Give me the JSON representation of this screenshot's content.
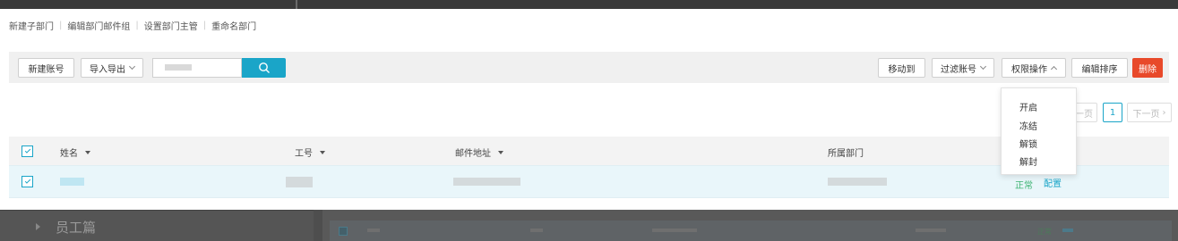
{
  "top_links": [
    "新建子部门",
    "编辑部门邮件组",
    "设置部门主管",
    "重命名部门"
  ],
  "toolbar": {
    "new_account": "新建账号",
    "import_export": "导入导出",
    "search_value": "",
    "move_to": "移动到",
    "filter_account": "过滤账号",
    "permission_ops": "权限操作",
    "edit_sort": "编辑排序",
    "delete": "删除"
  },
  "permission_menu": [
    "开启",
    "冻结",
    "解锁",
    "解封"
  ],
  "pagination": {
    "prev": "一页",
    "current": "1",
    "next": "下一页"
  },
  "table": {
    "columns": [
      "姓名",
      "工号",
      "邮件地址",
      "所属部门"
    ],
    "row": {
      "status": "正常",
      "action": "配置"
    }
  },
  "background": {
    "left_panel_label": "员工篇",
    "row_status": "正常"
  },
  "colors": {
    "accent": "#1aa5c8",
    "danger": "#e8492a",
    "status_green": "#3cb371"
  }
}
